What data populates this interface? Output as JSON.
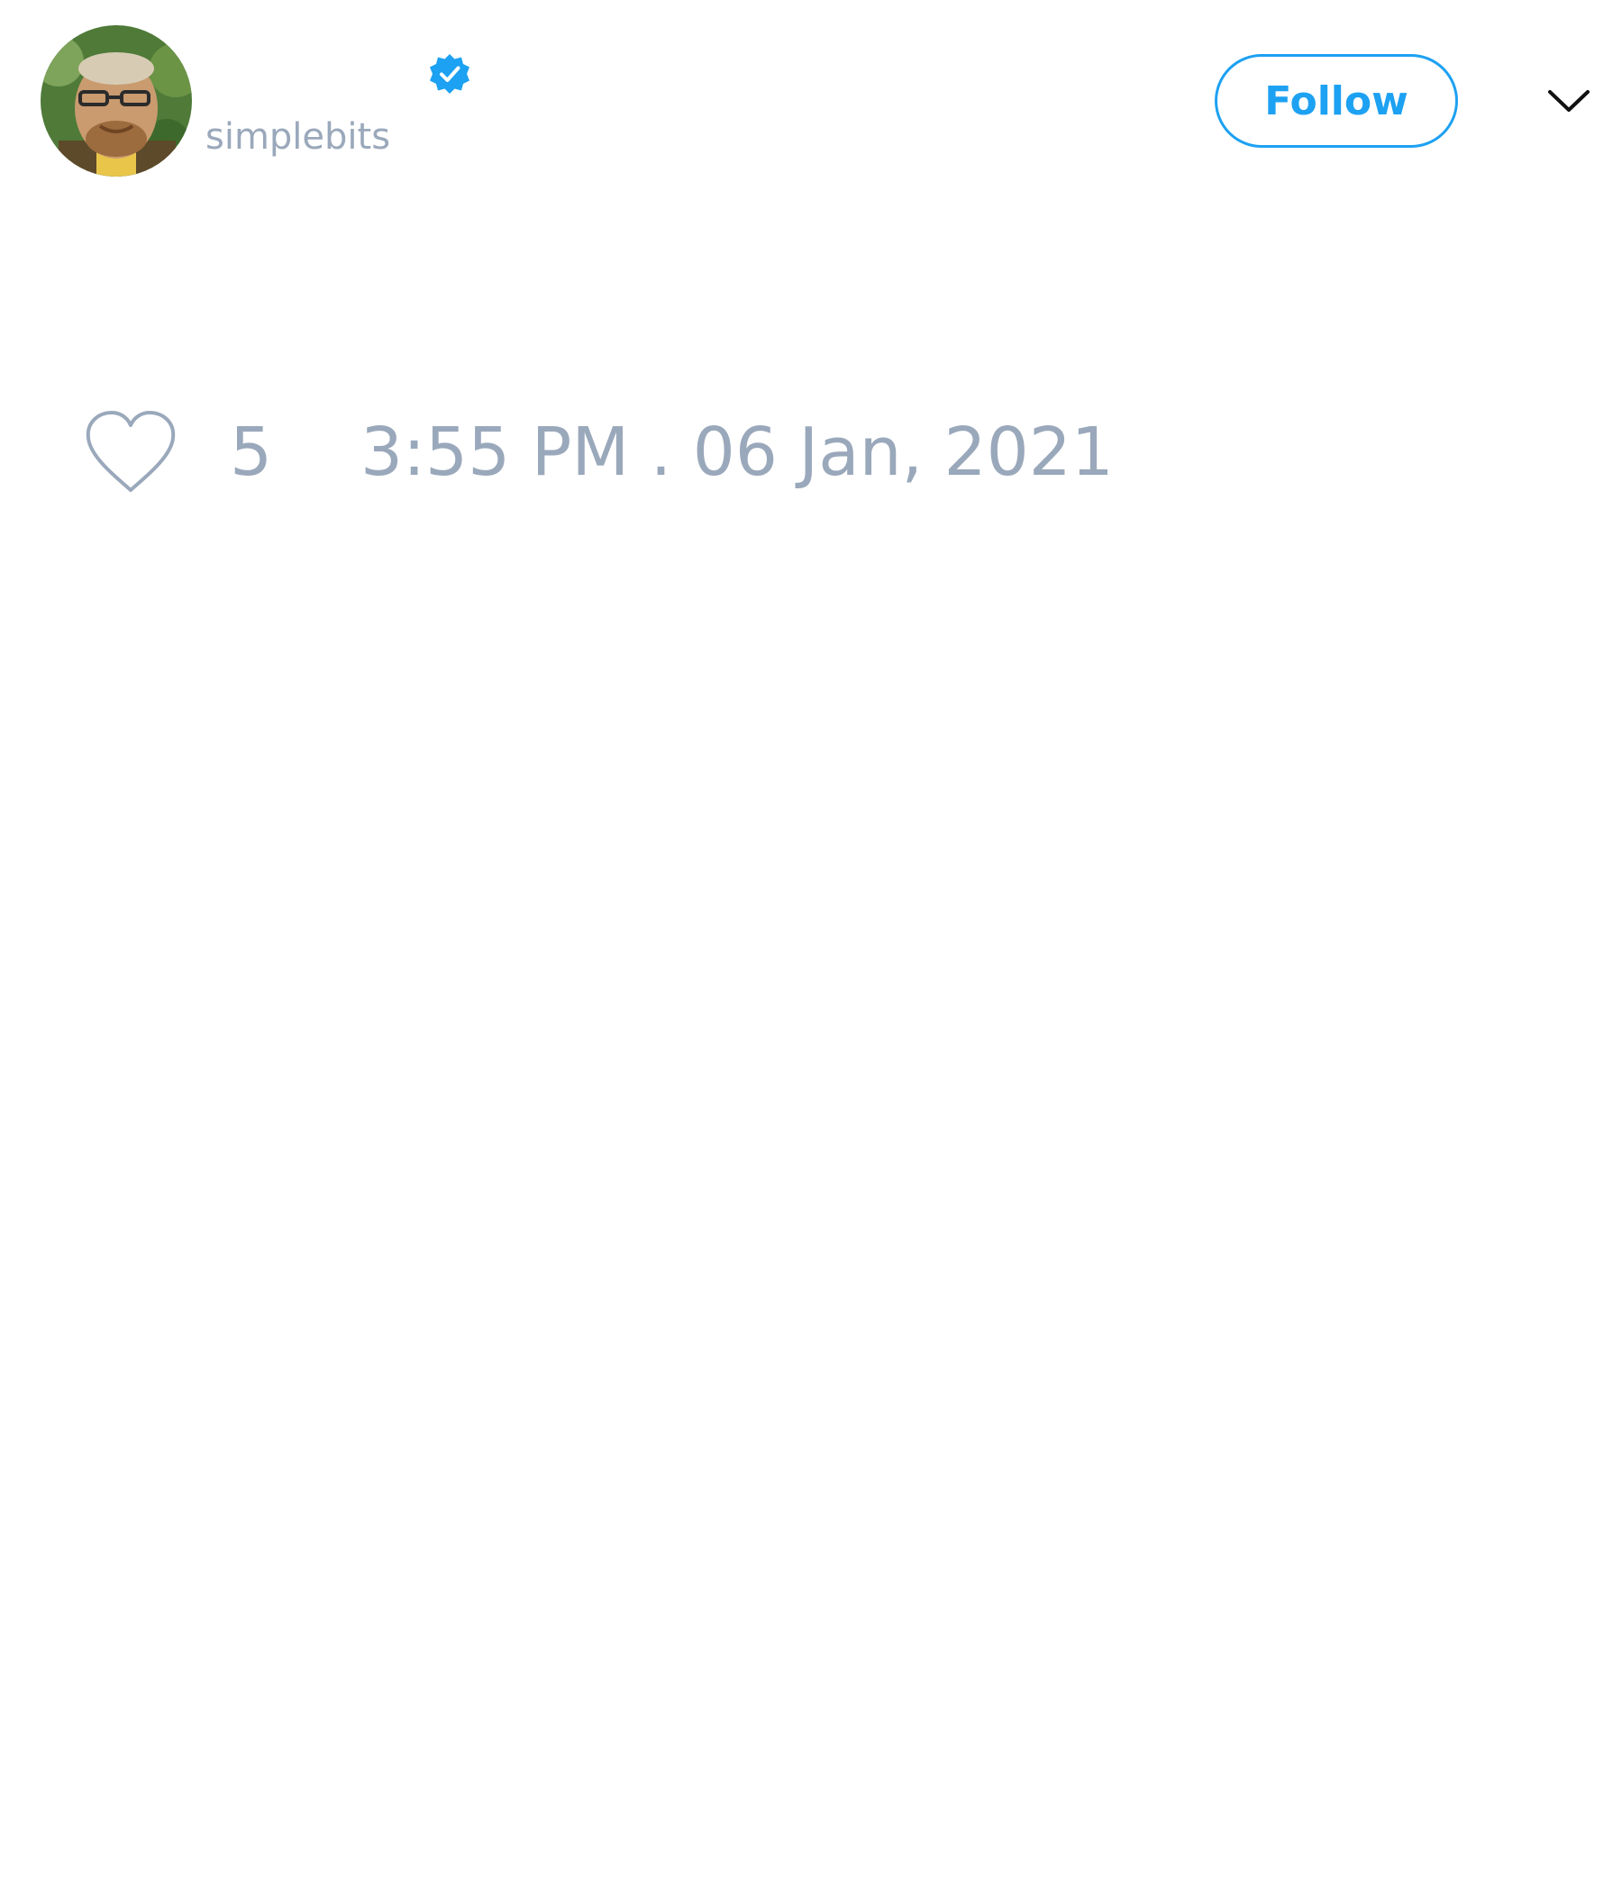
{
  "tweet": {
    "author": {
      "handle": "simplebits",
      "verified": true,
      "avatar_icon": "avatar-image"
    },
    "follow_label": "Follow",
    "menu_icon": "chevron-down-icon",
    "like_icon": "heart-icon",
    "like_count": "5",
    "timestamp": "3:55 PM . 06 Jan, 2021"
  },
  "colors": {
    "accent": "#1da1f2",
    "muted_text": "#9aa8bb",
    "background": "#ffffff"
  }
}
